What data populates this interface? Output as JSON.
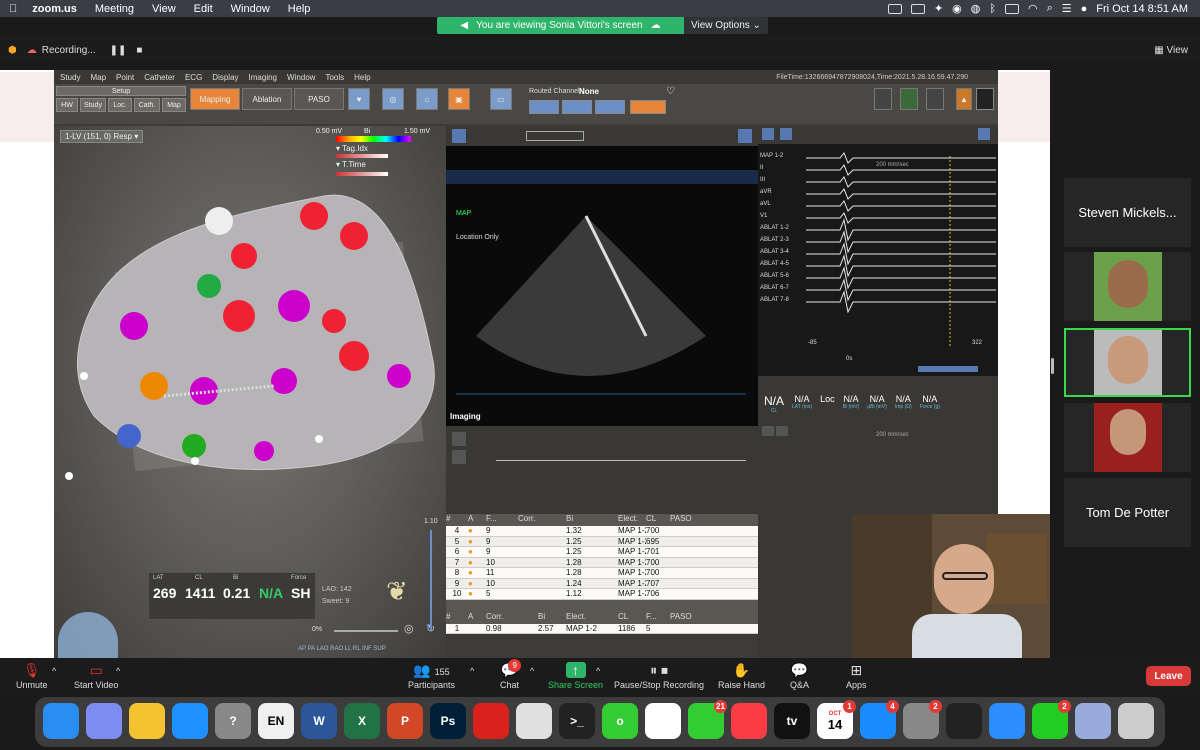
{
  "menubar": {
    "app": "zoom.us",
    "items": [
      "Meeting",
      "View",
      "Edit",
      "Window",
      "Help"
    ],
    "datetime": "Fri Oct 14  8:51 AM"
  },
  "banner": {
    "text": "You are viewing Sonia Vittori's screen",
    "view_options": "View Options"
  },
  "zoom_top": {
    "recording": "Recording...",
    "view": "View"
  },
  "carto": {
    "menu": [
      "Study",
      "Map",
      "Point",
      "Catheter",
      "ECG",
      "Display",
      "Imaging",
      "Window",
      "Tools",
      "Help"
    ],
    "filetime": "FileTime:132666947872908024,Time:2021.5.28.16.59.47.290",
    "setup": "Setup",
    "setup_tabs": [
      "HW",
      "Study",
      "Loc.",
      "Cath.",
      "Map"
    ],
    "mode_tabs": [
      "Mapping",
      "Ablation",
      "PASO"
    ],
    "routed_channel_label": "Routed Channel:",
    "routed_channel_value": "None",
    "map_name": "1-LV (151, 0) Resp",
    "scale": {
      "min": "0.50 mV",
      "title": "Bi",
      "max": "1.50 mV"
    },
    "legend": [
      "Tag.Idx",
      "T.Time"
    ],
    "us_labels": {
      "map": "MAP",
      "location": "Location Only",
      "imaging": "Imaging"
    },
    "status": {
      "lat": "269",
      "cl": "1411",
      "bi": "0.21",
      "uni": "N/A",
      "force": "SH",
      "lat_label": "LAT",
      "cl_label": "CL",
      "bi_label": "Bi",
      "force_label": "Force",
      "lao": "LAO:",
      "lao_val": "142",
      "sweet": "Sweet:",
      "sweet_val": "9",
      "pct": "0%",
      "views": "AP  PA  LAO  RAO  LL  RL  INF  SUP"
    },
    "ecg": {
      "speed": "200 mm/sec",
      "leads": [
        "MAP 1-2",
        "II",
        "III",
        "aVR",
        "aVL",
        "V1",
        "ABLAT 1-2",
        "ABLAT 2-3",
        "ABLAT 3-4",
        "ABLAT 4-5",
        "ABLAT 5-6",
        "ABLAT 6-7",
        "ABLAT 7-8"
      ],
      "t_start": "-85",
      "t_zero": "0s",
      "t_end": "322"
    },
    "readout": [
      {
        "v": "N/A",
        "l": "CL"
      },
      {
        "v": "N/A",
        "l": "LAT (ms)"
      },
      {
        "v": "Loc",
        "l": ""
      },
      {
        "v": "N/A",
        "l": "Bi (mV)"
      },
      {
        "v": "N/A",
        "l": "μBi (mV)"
      },
      {
        "v": "N/A",
        "l": "Imp (Ω)"
      },
      {
        "v": "N/A",
        "l": "Force (g)"
      }
    ],
    "readout_speed": "200 mm/sec",
    "zoom_value": "1.10",
    "table": {
      "headers": [
        "#",
        "A",
        "F...",
        "Corr.",
        "",
        "Bi",
        "Elect.",
        "CL",
        "PASO"
      ],
      "rows": [
        {
          "n": "4",
          "f": "9",
          "bi": "1.32",
          "el": "MAP 1-2",
          "cl": "700"
        },
        {
          "n": "5",
          "f": "9",
          "bi": "1.25",
          "el": "MAP 1-2",
          "cl": "695"
        },
        {
          "n": "6",
          "f": "9",
          "bi": "1.25",
          "el": "MAP 1-2",
          "cl": "701"
        },
        {
          "n": "7",
          "f": "10",
          "bi": "1.28",
          "el": "MAP 1-2",
          "cl": "700"
        },
        {
          "n": "8",
          "f": "11",
          "bi": "1.28",
          "el": "MAP 1-2",
          "cl": "700"
        },
        {
          "n": "9",
          "f": "10",
          "bi": "1.24",
          "el": "MAP 1-2",
          "cl": "707"
        },
        {
          "n": "10",
          "f": "5",
          "bi": "1.12",
          "el": "MAP 1-2",
          "cl": "706"
        }
      ]
    },
    "table2": {
      "headers": [
        "#",
        "A",
        "Corr.",
        "",
        "Bi",
        "Elect.",
        "CL",
        "F...",
        "PASO"
      ],
      "row": {
        "n": "1",
        "corr": "0.98",
        "bi": "2.57",
        "el": "MAP 1-2",
        "cl": "1186",
        "f": "5"
      }
    }
  },
  "participants": [
    "Steven Mickels...",
    "Tom De Potter"
  ],
  "controls": {
    "unmute": "Unmute",
    "video": "Start Video",
    "participants": "Participants",
    "participants_count": "155",
    "chat": "Chat",
    "chat_badge": "9",
    "share": "Share Screen",
    "record": "Pause/Stop Recording",
    "raise": "Raise Hand",
    "qa": "Q&A",
    "apps": "Apps",
    "leave": "Leave"
  },
  "dock": [
    {
      "n": "Finder",
      "c": "#2a8ef0"
    },
    {
      "n": "Launchpad",
      "c": "#7d8cf0"
    },
    {
      "n": "Drive",
      "c": "#f4c430"
    },
    {
      "n": "Safari",
      "c": "#1e90ff"
    },
    {
      "n": "?",
      "c": "#888"
    },
    {
      "n": "EN",
      "c": "#f0f0f0"
    },
    {
      "n": "W",
      "c": "#2b579a"
    },
    {
      "n": "X",
      "c": "#217346"
    },
    {
      "n": "P",
      "c": "#d24726"
    },
    {
      "n": "Ps",
      "c": "#001e36"
    },
    {
      "n": "Acrobat",
      "c": "#d9221c"
    },
    {
      "n": "Scrivener",
      "c": "#e0e0e0"
    },
    {
      "n": ">_",
      "c": "#222"
    },
    {
      "n": "o",
      "c": "#3c3"
    },
    {
      "n": "Photos",
      "c": "#fff"
    },
    {
      "n": "Messages",
      "c": "#3c3"
    },
    {
      "n": "Music",
      "c": "#fc3c44"
    },
    {
      "n": "tv",
      "c": "#111"
    },
    {
      "n": "14",
      "c": "#fff"
    },
    {
      "n": "AppStore",
      "c": "#1a8cff"
    },
    {
      "n": "Settings",
      "c": "#888"
    },
    {
      "n": "Monitor",
      "c": "#222"
    },
    {
      "n": "Zoom",
      "c": "#2d8cff"
    },
    {
      "n": "FaceTime",
      "c": "#2c2"
    },
    {
      "n": "Preview",
      "c": "#9ad"
    },
    {
      "n": "Trash",
      "c": "#ccc"
    }
  ],
  "dock_badges": {
    "messages": "21",
    "appstore": "4",
    "settings": "2",
    "facetime": "2",
    "calendar_month": "OCT",
    "calendar_day": "14",
    "calendar_badge": "1"
  }
}
